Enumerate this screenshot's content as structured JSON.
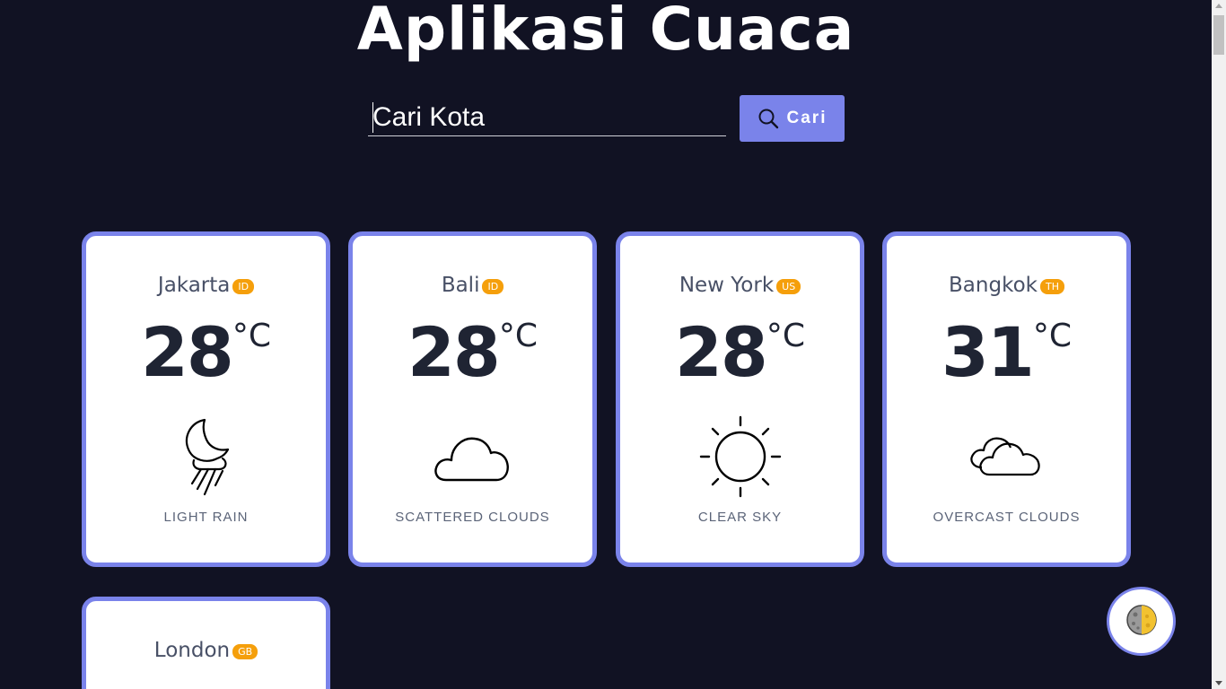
{
  "header": {
    "title": "Aplikasi Cuaca"
  },
  "search": {
    "placeholder": "Cari Kota",
    "button_label": "Cari"
  },
  "colors": {
    "background": "#111223",
    "accent": "#7a83ea",
    "badge": "#f59f0b"
  },
  "cards": [
    {
      "city": "Jakarta",
      "country": "ID",
      "temp": "28",
      "unit": "°C",
      "description": "LIGHT RAIN",
      "icon": "moon-rain-icon"
    },
    {
      "city": "Bali",
      "country": "ID",
      "temp": "28",
      "unit": "°C",
      "description": "SCATTERED CLOUDS",
      "icon": "cloud-icon"
    },
    {
      "city": "New York",
      "country": "US",
      "temp": "28",
      "unit": "°C",
      "description": "CLEAR SKY",
      "icon": "sun-icon"
    },
    {
      "city": "Bangkok",
      "country": "TH",
      "temp": "31",
      "unit": "°C",
      "description": "OVERCAST CLOUDS",
      "icon": "overcast-clouds-icon"
    },
    {
      "city": "London",
      "country": "GB"
    }
  ],
  "theme_toggle": {
    "icon": "moon-phase-icon"
  }
}
